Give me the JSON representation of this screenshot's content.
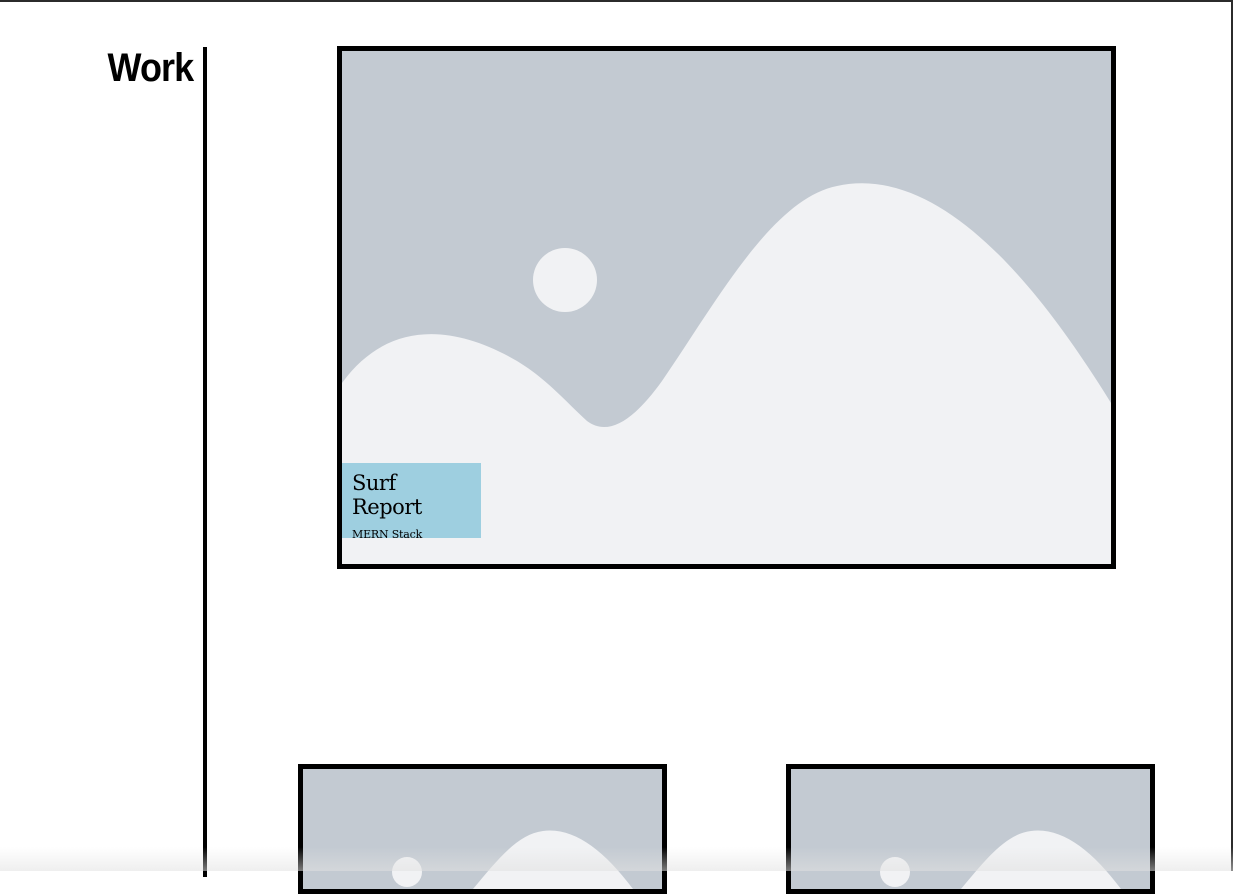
{
  "page": {
    "section_title": "Work"
  },
  "projects": [
    {
      "title": "Surf Report",
      "subtitle": "MERN Stack",
      "image_icon": "image-placeholder-icon"
    },
    {
      "image_icon": "image-placeholder-icon"
    },
    {
      "image_icon": "image-placeholder-icon"
    }
  ],
  "colors": {
    "placeholder_bg": "#c3cad2",
    "placeholder_fg": "#f1f2f4",
    "caption_bg": "#9ecfe0",
    "border": "#000000"
  }
}
